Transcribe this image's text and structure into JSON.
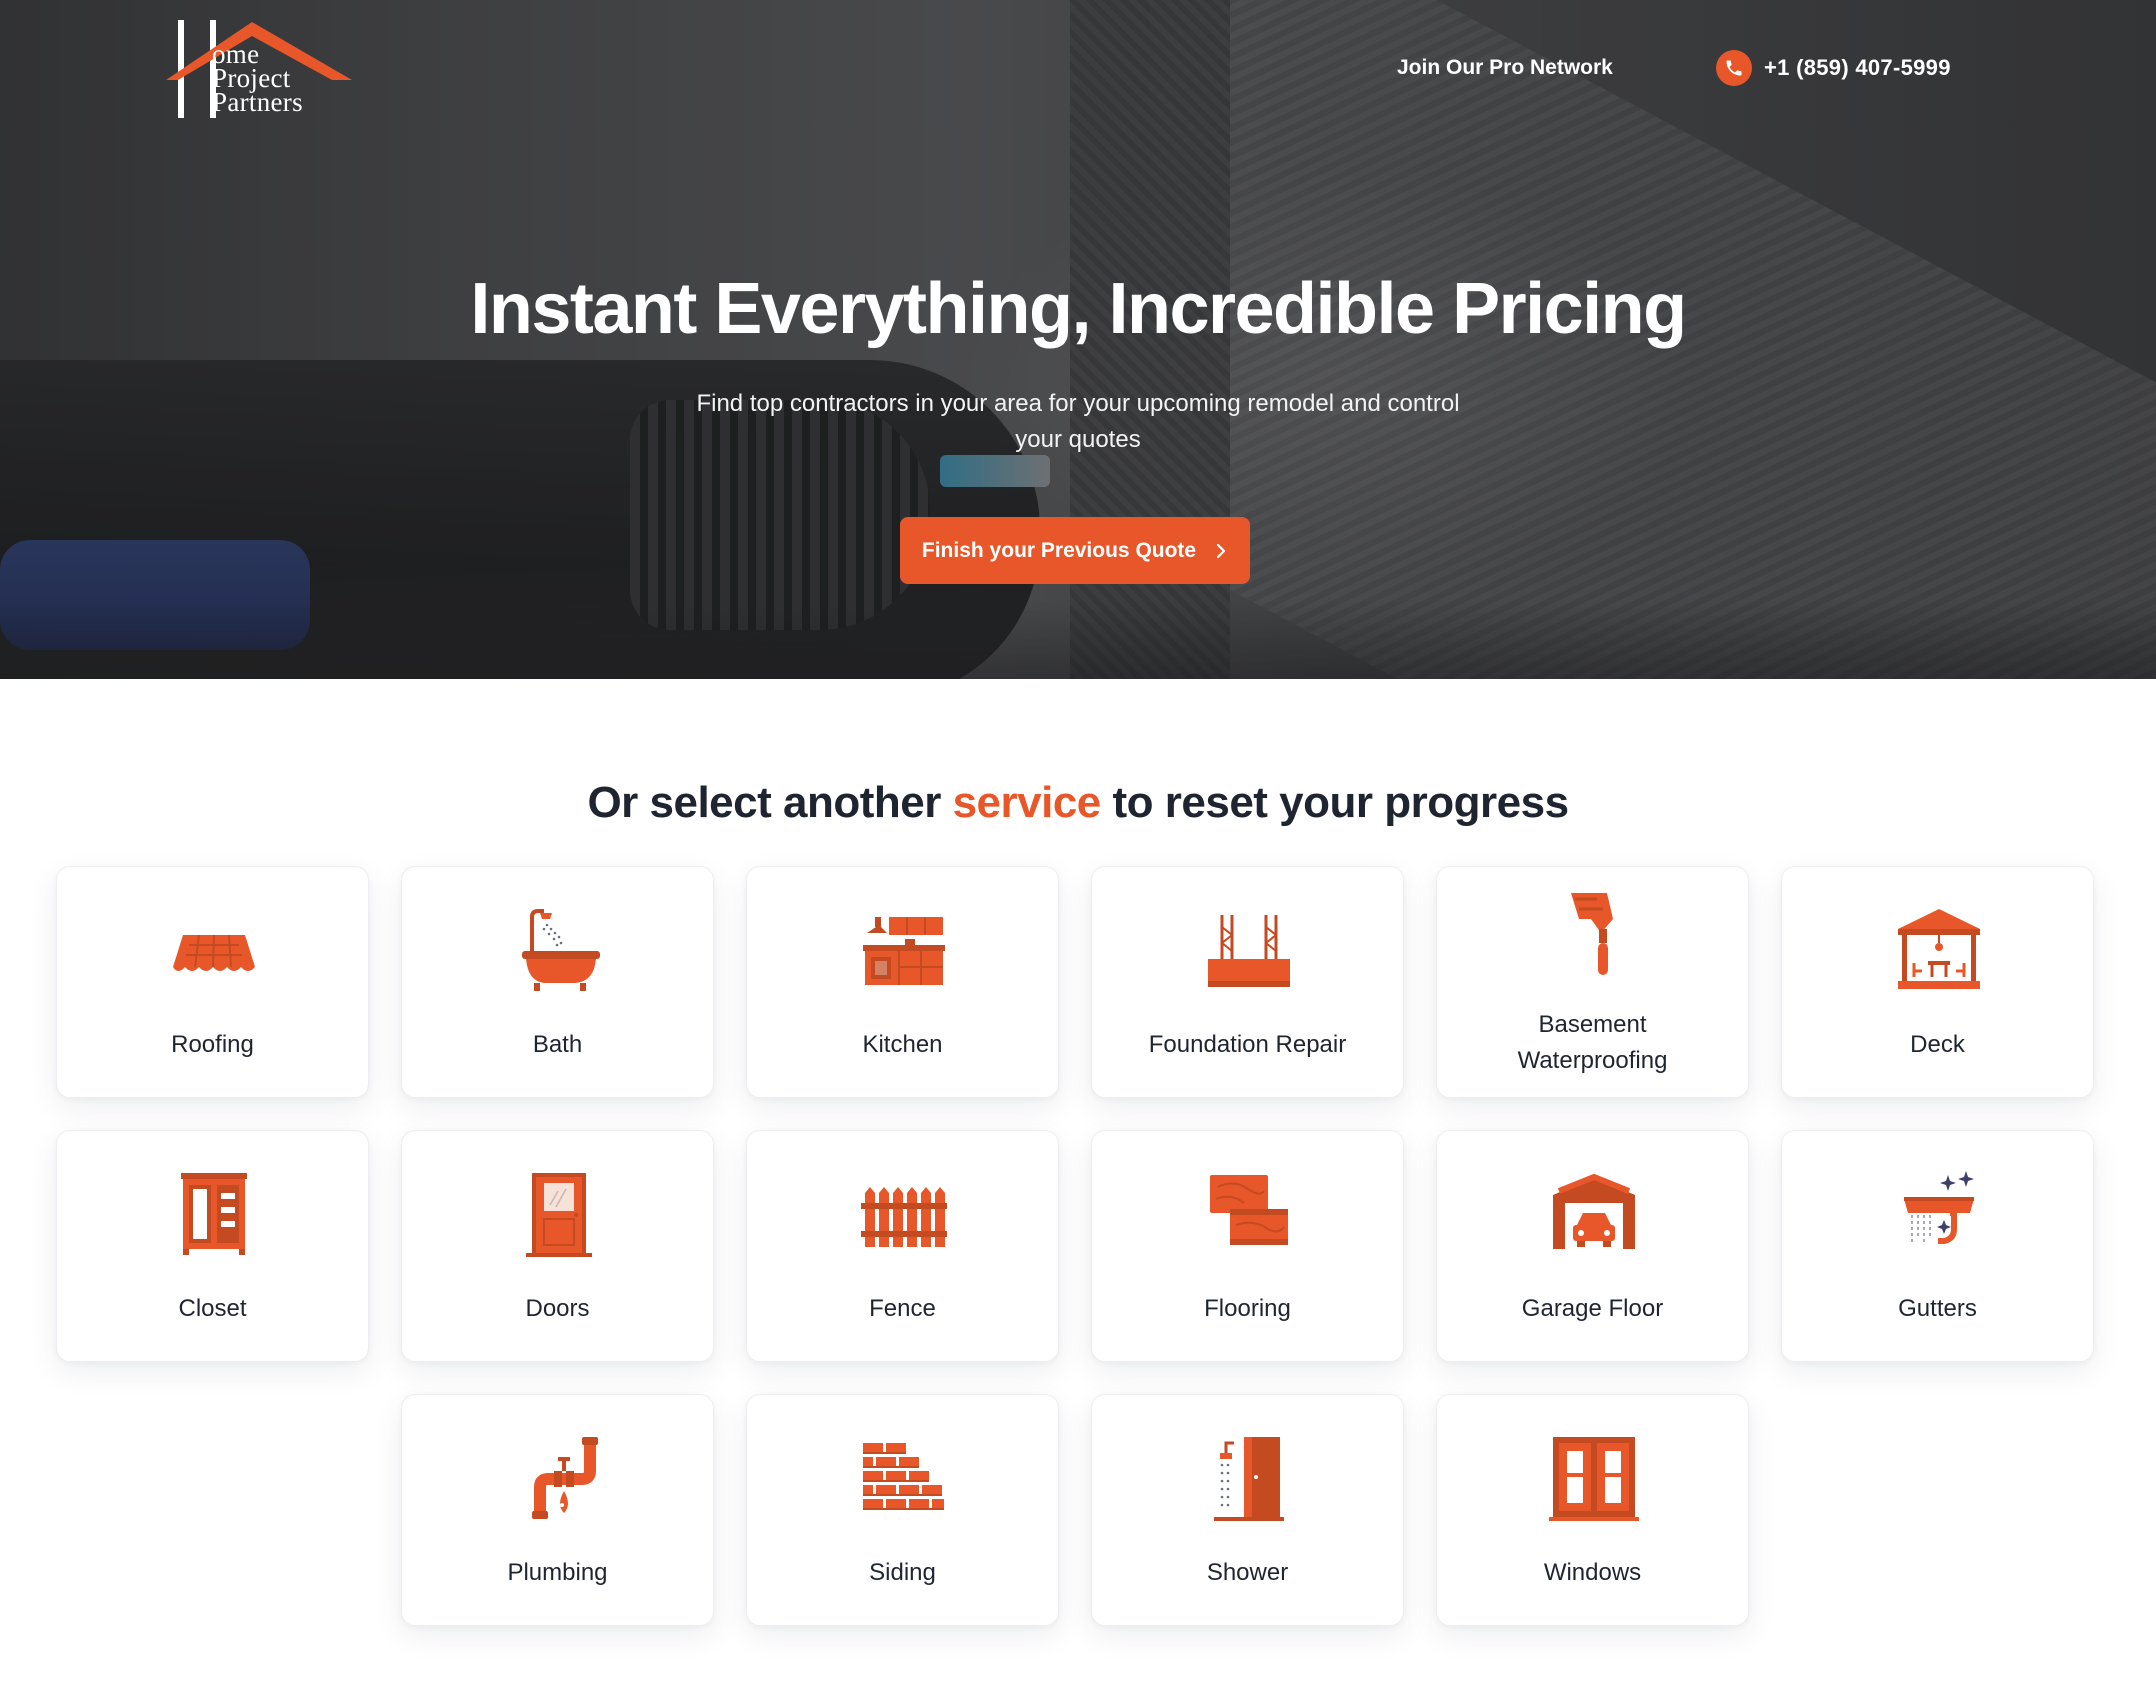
{
  "header": {
    "logo_text_1": "ome",
    "logo_text_2": "Project",
    "logo_text_3": "Partners",
    "join_label": "Join Our Pro Network",
    "phone": "+1 (859) 407-5999"
  },
  "hero": {
    "title": "Instant Everything, Incredible Pricing",
    "subtitle": "Find top contractors in your area for your upcoming remodel and control your quotes",
    "cta_label": "Finish your Previous Quote",
    "cta_icon": "chevron-right-icon"
  },
  "services": {
    "title_pre": "Or select another ",
    "title_accent": "service",
    "title_post": " to reset your progress",
    "items": [
      {
        "label": "Roofing",
        "icon": "roofing-icon"
      },
      {
        "label": "Bath",
        "icon": "bathtub-icon"
      },
      {
        "label": "Kitchen",
        "icon": "kitchen-icon"
      },
      {
        "label": "Foundation Repair",
        "icon": "foundation-icon"
      },
      {
        "label": "Basement Waterproofing",
        "icon": "trowel-icon"
      },
      {
        "label": "Deck",
        "icon": "gazebo-icon"
      },
      {
        "label": "Closet",
        "icon": "closet-icon"
      },
      {
        "label": "Doors",
        "icon": "door-icon"
      },
      {
        "label": "Fence",
        "icon": "fence-icon"
      },
      {
        "label": "Flooring",
        "icon": "flooring-icon"
      },
      {
        "label": "Garage Floor",
        "icon": "garage-icon"
      },
      {
        "label": "Gutters",
        "icon": "gutter-icon"
      },
      {
        "label": "Plumbing",
        "icon": "pipe-icon"
      },
      {
        "label": "Siding",
        "icon": "brick-icon"
      },
      {
        "label": "Shower",
        "icon": "shower-icon"
      },
      {
        "label": "Windows",
        "icon": "window-icon"
      }
    ]
  },
  "colors": {
    "accent": "#e8572a",
    "icon_dark": "#c44a22",
    "text_dark": "#1f2530"
  }
}
